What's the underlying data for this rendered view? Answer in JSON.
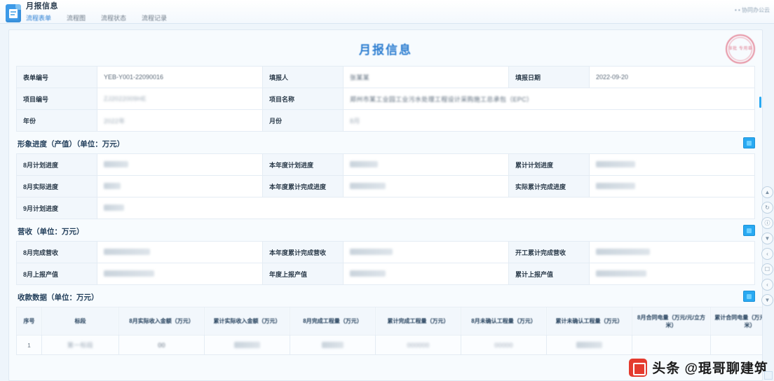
{
  "window": {
    "title": "月报信息",
    "right_hint": "• • 协同办公云",
    "tabs": [
      {
        "label": "流程表单",
        "active": true
      },
      {
        "label": "流程图",
        "active": false
      },
      {
        "label": "流程状态",
        "active": false
      },
      {
        "label": "流程记录",
        "active": false
      }
    ]
  },
  "document": {
    "title": "月报信息",
    "stamp_text": "审批 专用章"
  },
  "header_fields": {
    "form_no_label": "表单编号",
    "form_no_value": "YEB-Y001-22090016",
    "reporter_label": "填报人",
    "reporter_value": "张某某",
    "report_date_label": "填报日期",
    "report_date_value": "2022-09-20",
    "project_no_label": "项目编号",
    "project_no_value": "ZJ2022009HE",
    "project_name_label": "项目名称",
    "project_name_value": "郑州市某工业园工业污水处理工程设计采购施工总承包（EPC）",
    "year_label": "年份",
    "year_value": "2022年",
    "month_label": "月份",
    "month_value": "8月"
  },
  "progress_section": {
    "title": "形象进度（产值）（单位：万元）",
    "rows": [
      {
        "c1_label": "8月计划进度",
        "c1_value": "0000.00",
        "c2_label": "本年度计划进度",
        "c2_value": "00000.00",
        "c3_label": "累计计划进度",
        "c3_value": "00000000.00"
      },
      {
        "c1_label": "8月实际进度",
        "c1_value": "000.0",
        "c2_label": "本年度累计完成进度",
        "c2_value": "0000000.00",
        "c3_label": "实际累计完成进度",
        "c3_value": "00000000.00"
      },
      {
        "c1_label": "9月计划进度",
        "c1_value": "0000.0",
        "c2_label": "",
        "c2_value": "",
        "c3_label": "",
        "c3_value": ""
      }
    ]
  },
  "revenue_section": {
    "title": "营收（单位：万元）",
    "rows": [
      {
        "c1_label": "8月完成营收",
        "c1_value": "00000000000.0",
        "c2_label": "本年度累计完成营收",
        "c2_value": "000000000.00",
        "c3_label": "开工累计完成营收",
        "c3_value": "0000000000000.0"
      },
      {
        "c1_label": "8月上报产值",
        "c1_value": "000000000000.0",
        "c2_label": "年度上报产值",
        "c2_value": "0000000.00",
        "c3_label": "累计上报产值",
        "c3_value": "00000000000.00"
      }
    ]
  },
  "receipt_section": {
    "title": "收款数据（单位：万元）",
    "columns": [
      "序号",
      "标段",
      "8月实际收入金额（万元）",
      "累计实际收入金额（万元）",
      "8月完成工程量（万元）",
      "累计完成工程量（万元）",
      "8月未确认工程量（万元）",
      "累计未确认工程量（万元）",
      "8月合同电量（万元/元/立方米）",
      "累计合同电量（万元/元/立方米）"
    ],
    "rows": [
      [
        "1",
        "第一标段",
        "00",
        "0000000",
        "000000",
        "000000",
        "00000",
        "0000000",
        "",
        ""
      ]
    ]
  },
  "side_rail": {
    "buttons": [
      "top-icon",
      "refresh-icon",
      "info-icon",
      "filter-icon",
      "back-icon",
      "copy-icon",
      "prev-icon",
      "bottom-icon"
    ]
  },
  "watermark": {
    "text": "头条 @琨哥聊建筑"
  }
}
